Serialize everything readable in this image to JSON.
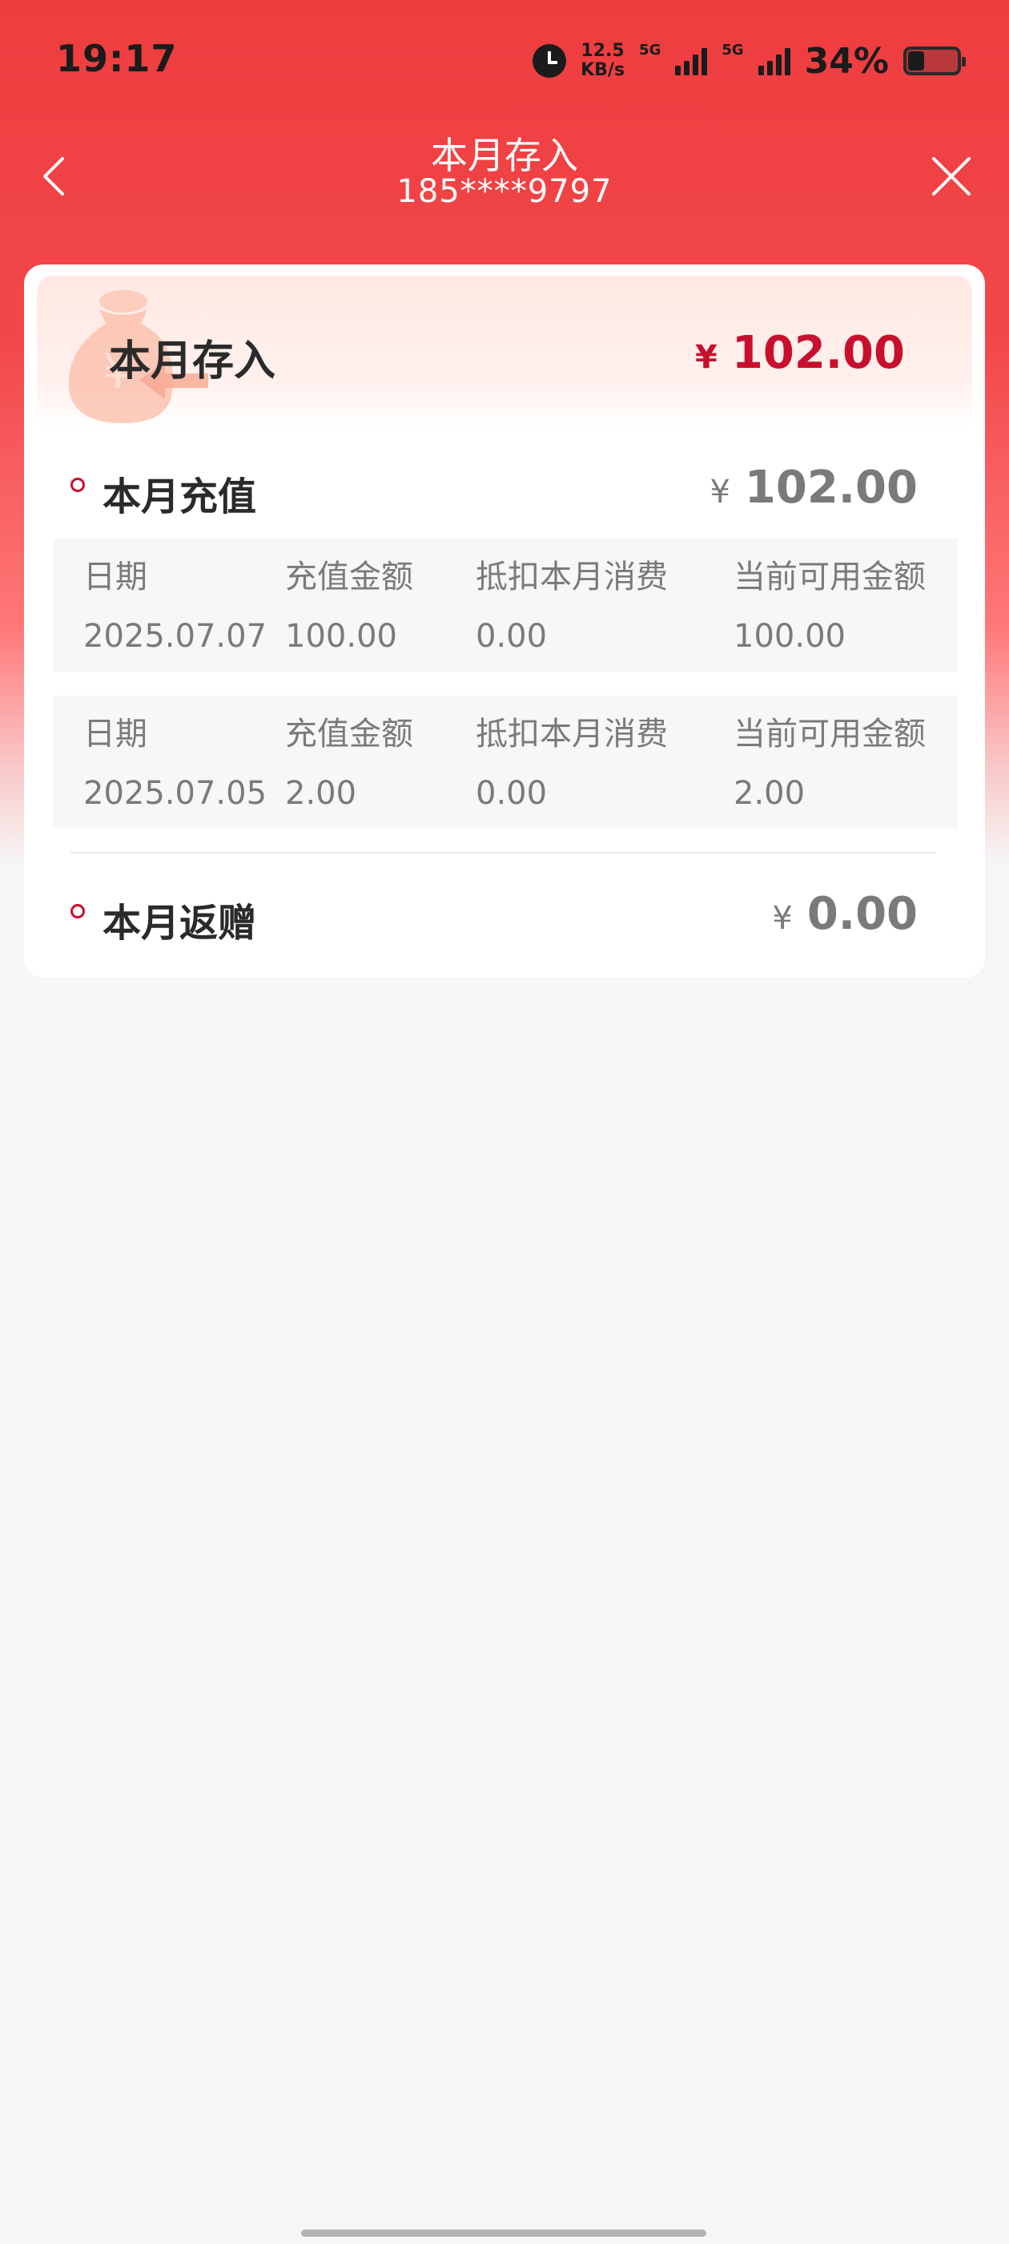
{
  "status_bar": {
    "time": "19:17",
    "speed_value": "12.5",
    "speed_unit": "KB/s",
    "net_1": "5G",
    "net_2": "5G",
    "battery_pct": "34%",
    "icons": [
      "alarm-icon",
      "signal-icon",
      "signal-icon",
      "battery-icon"
    ]
  },
  "nav": {
    "title": "本月存入",
    "subtitle": "185****9797",
    "back_icon": "chevron-left-icon",
    "close_icon": "close-icon"
  },
  "summary": {
    "title": "本月存入",
    "currency": "¥",
    "amount": "102.00",
    "deco_icon": "money-bag-icon"
  },
  "recharge": {
    "label": "本月充值",
    "currency": "¥",
    "amount": "102.00",
    "headers": {
      "date": "日期",
      "amount": "充值金额",
      "deduct": "抵扣本月消费",
      "available": "当前可用金额"
    },
    "records": [
      {
        "date": "2025.07.07",
        "amount": "100.00",
        "deduct": "0.00",
        "available": "100.00"
      },
      {
        "date": "2025.07.05",
        "amount": "2.00",
        "deduct": "0.00",
        "available": "2.00"
      }
    ]
  },
  "bonus": {
    "label": "本月返赠",
    "currency": "¥",
    "amount": "0.00"
  },
  "colors": {
    "accent": "#c8102e",
    "header_red": "#ee3d3f",
    "page_bg": "#f6f6f6"
  }
}
